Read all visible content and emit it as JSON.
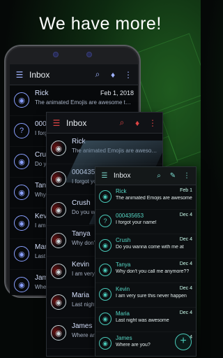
{
  "headline": "We have more!",
  "screen1": {
    "title": "Inbox",
    "rows": [
      {
        "name": "Rick",
        "date": "Feb 1, 2018",
        "msg": "The animated Emojis are awesome too!..",
        "check": "✓",
        "avatar": "person"
      },
      {
        "name": "000435",
        "date": "",
        "msg": "I forgot",
        "check": "",
        "avatar": "?"
      },
      {
        "name": "Crush",
        "date": "",
        "msg": "Do you",
        "check": "",
        "avatar": "person"
      },
      {
        "name": "Tanya",
        "date": "",
        "msg": "Why don",
        "check": "",
        "avatar": "person"
      },
      {
        "name": "Kevin",
        "date": "",
        "msg": "I am ver",
        "check": "",
        "avatar": "person"
      },
      {
        "name": "Maria",
        "date": "",
        "msg": "Last nigh",
        "check": "",
        "avatar": "person"
      },
      {
        "name": "James",
        "date": "",
        "msg": "Where ar",
        "check": "",
        "avatar": "person"
      }
    ]
  },
  "screen2": {
    "title": "Inbox",
    "rows": [
      {
        "name": "Rick",
        "date": "",
        "msg": "The animated Emojis are awesome",
        "check": "✓"
      },
      {
        "name": "000435653",
        "date": "",
        "msg": "I forgot you",
        "check": ""
      },
      {
        "name": "Crush",
        "date": "",
        "msg": "Do you wa",
        "check": ""
      },
      {
        "name": "Tanya",
        "date": "",
        "msg": "Why don't yo",
        "check": ""
      },
      {
        "name": "Kevin",
        "date": "",
        "msg": "I am very su",
        "check": ""
      },
      {
        "name": "Maria",
        "date": "",
        "msg": "Last night w",
        "check": ""
      },
      {
        "name": "James",
        "date": "",
        "msg": "Where are yo",
        "check": ""
      }
    ]
  },
  "screen3": {
    "title": "Inbox",
    "rows": [
      {
        "name": "Rick",
        "date": "Feb 1",
        "msg": "The animated Emojis are awesome",
        "avatar": "person"
      },
      {
        "name": "000435653",
        "date": "Dec 4",
        "msg": "I forgot your name!",
        "avatar": "?"
      },
      {
        "name": "Crush",
        "date": "Dec 4",
        "msg": "Do you wanna come with me at",
        "avatar": "person"
      },
      {
        "name": "Tanya",
        "date": "Dec 4",
        "msg": "Why don't you call me anymore??",
        "avatar": "person"
      },
      {
        "name": "Kevin",
        "date": "Dec 4",
        "msg": "I am very sure this never happen",
        "avatar": "person"
      },
      {
        "name": "Maria",
        "date": "Dec 4",
        "msg": "Last night was awesome",
        "avatar": "person"
      },
      {
        "name": "James",
        "date": "Dec 4",
        "msg": "Where are you?",
        "avatar": "person"
      }
    ],
    "fab": "+"
  },
  "icons": {
    "menu": "menu-icon",
    "search": "search-icon",
    "shirt": "theme-icon",
    "more": "more-vert-icon"
  }
}
